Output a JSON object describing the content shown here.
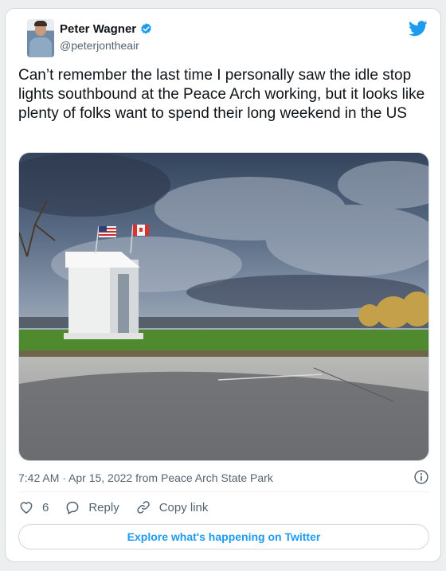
{
  "author": {
    "display_name": "Peter Wagner",
    "handle": "@peterjontheair",
    "verified": true
  },
  "tweet": {
    "text": "Can’t remember the last time I personally saw the idle stop lights southbound at the Peace Arch working, but it looks like plenty of folks want to spend their long weekend in the US"
  },
  "meta": {
    "line": "7:42 AM · Apr 15, 2022 from Peace Arch State Park"
  },
  "actions": {
    "like_count": "6",
    "reply_label": "Reply",
    "copy_link_label": "Copy link"
  },
  "footer": {
    "explore_label": "Explore what's happening on Twitter"
  },
  "icons": {
    "brand": "twitter-bird-icon",
    "verified": "verified-badge-icon",
    "info": "info-icon",
    "like": "heart-icon",
    "reply": "reply-bubble-icon",
    "copy_link": "link-icon"
  },
  "colors": {
    "accent": "#1d9bf0",
    "text": "#0f1419",
    "secondary": "#536471",
    "border": "#cfd9de"
  }
}
